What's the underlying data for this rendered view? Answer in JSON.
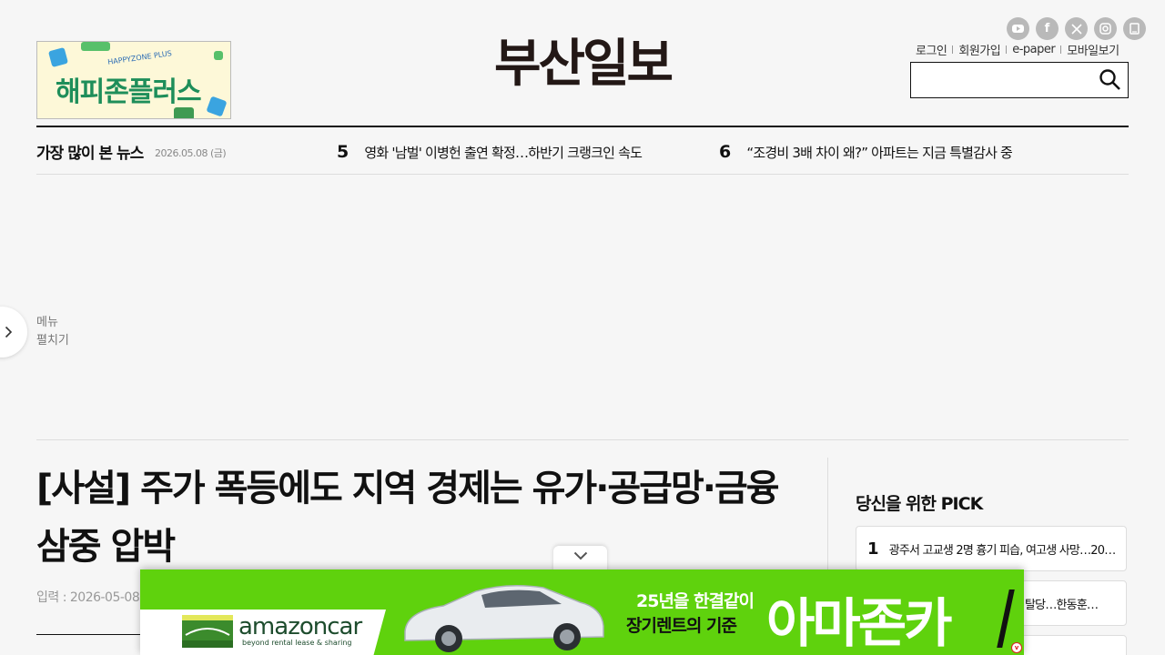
{
  "header": {
    "logo_text": "부산일보",
    "social": [
      "youtube-icon",
      "facebook-icon",
      "x-icon",
      "instagram-icon",
      "app-icon"
    ],
    "links": {
      "login": "로그인",
      "signup": "회원가입",
      "epaper": "e-paper",
      "mobile": "모바일보기"
    },
    "search": {
      "value": "",
      "placeholder": ""
    },
    "promo": {
      "subtitle": "HAPPYZONE PLUS",
      "title": "해피존플러스"
    }
  },
  "most_viewed": {
    "title": "가장 많이 본 뉴스",
    "date": "2026.05.08 (금)",
    "items": [
      {
        "rank": "5",
        "text": "영화 '남벌' 이병헌 출연 확정…하반기 크랭크인 속도"
      },
      {
        "rank": "6",
        "text": "“조경비 3배 차이 왜?” 아파트는 지금 특별감사 중"
      }
    ]
  },
  "side_menu": {
    "label_line1": "메뉴",
    "label_line2": "펼치기"
  },
  "article": {
    "headline": "[사설] 주가 폭등에도 지역 경제는 유가·공급망·금융 삼중 압박",
    "meta": "입력 : 2026-05-08 05:"
  },
  "pick": {
    "title": "당신을 위한 PICK",
    "items": [
      {
        "rank": "1",
        "text": "광주서 고교생 2명 흉기 피습, 여고생 사망…20…"
      },
      {
        "rank": "",
        "text": "탈당…한동훈…"
      },
      {
        "rank": "",
        "text": ""
      }
    ]
  },
  "ad": {
    "brand": "amazoncar",
    "tagline": "beyond rental lease & sharing",
    "copy_line1": "25년을 한결같이",
    "copy_line2": "장기렌트의 기준",
    "big_text": "아마존카",
    "accent_color": "#5fd20d"
  }
}
